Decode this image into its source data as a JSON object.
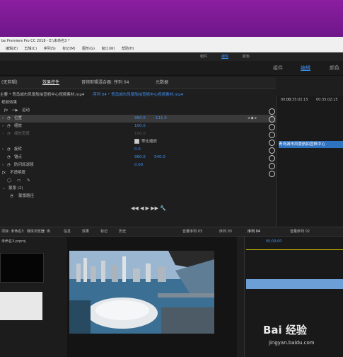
{
  "app": {
    "title": "be Premiere Pro CC 2018 - E:\\未命名3 *",
    "menu": [
      "编辑(E)",
      "剪辑(C)",
      "序列(S)",
      "标记(M)",
      "图形(G)",
      "窗口(W)",
      "帮助(H)"
    ]
  },
  "workspace": {
    "small_tabs": [
      "组件",
      "编辑",
      "颜色"
    ],
    "big_tabs": [
      "组件",
      "编辑",
      "颜色"
    ],
    "active": "编辑"
  },
  "panel_tabs": {
    "source": "(无剪辑)",
    "effect_controls": "效果控件",
    "audio_mixer": "音频剪辑混合器: 序列 04",
    "metadata": "元数据"
  },
  "effect_controls": {
    "master": "主要 * 青岛城市风景航拍宣帆中心视频素材.mp4",
    "sequence": "序列 04 * 青岛城市风景航拍宣帆中心视频素材.mp4",
    "section": "视频效果",
    "motion": "运动",
    "position_label": "位置",
    "position_x": "960.0",
    "position_y": "-111.0",
    "scale_label": "缩放",
    "scale_value": "100.0",
    "scale_width_label": "缩放宽度",
    "uniform_label": "等比缩放",
    "rotation_label": "旋转",
    "rotation_value": "0.0",
    "anchor_label": "锚点",
    "anchor_x": "960.0",
    "anchor_y": "540.0",
    "flicker_label": "防闪烁滤镜",
    "flicker_value": "0.00",
    "opacity_label": "不透明度",
    "mask_group": "蒙版 (2)",
    "mask_path": "蒙版路径",
    "opacity_left": "0",
    "key_value": "0"
  },
  "timeline_header": {
    "time1": "00;00",
    "time2": "00:35:02:15",
    "time3": "00:35:02:15",
    "clip_label": "青岛城市风景航拍宣帆中心"
  },
  "bottom_tabs": {
    "left": [
      "项目: 未命名3",
      "媒体浏览器",
      "库",
      "信息",
      "效果",
      "标记",
      "历史"
    ],
    "mid": [
      "音量序列 03",
      "序列 03",
      "序列 04",
      "音量序列 02"
    ],
    "project_item": "未命名3.prproj"
  },
  "program": {
    "timecode": "00;00;00",
    "footer": "0:00:00"
  },
  "watermark": {
    "text": "Bai 经验",
    "url": "jingyan.baidu.com"
  }
}
